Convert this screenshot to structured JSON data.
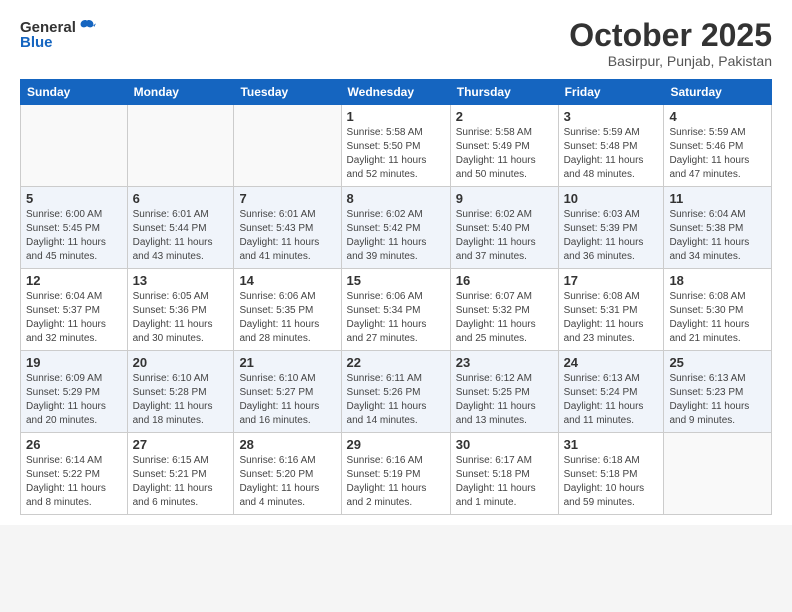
{
  "logo": {
    "general": "General",
    "blue": "Blue"
  },
  "header": {
    "month": "October 2025",
    "location": "Basirpur, Punjab, Pakistan"
  },
  "weekdays": [
    "Sunday",
    "Monday",
    "Tuesday",
    "Wednesday",
    "Thursday",
    "Friday",
    "Saturday"
  ],
  "weeks": [
    [
      {
        "day": "",
        "info": ""
      },
      {
        "day": "",
        "info": ""
      },
      {
        "day": "",
        "info": ""
      },
      {
        "day": "1",
        "info": "Sunrise: 5:58 AM\nSunset: 5:50 PM\nDaylight: 11 hours and 52 minutes."
      },
      {
        "day": "2",
        "info": "Sunrise: 5:58 AM\nSunset: 5:49 PM\nDaylight: 11 hours and 50 minutes."
      },
      {
        "day": "3",
        "info": "Sunrise: 5:59 AM\nSunset: 5:48 PM\nDaylight: 11 hours and 48 minutes."
      },
      {
        "day": "4",
        "info": "Sunrise: 5:59 AM\nSunset: 5:46 PM\nDaylight: 11 hours and 47 minutes."
      }
    ],
    [
      {
        "day": "5",
        "info": "Sunrise: 6:00 AM\nSunset: 5:45 PM\nDaylight: 11 hours and 45 minutes."
      },
      {
        "day": "6",
        "info": "Sunrise: 6:01 AM\nSunset: 5:44 PM\nDaylight: 11 hours and 43 minutes."
      },
      {
        "day": "7",
        "info": "Sunrise: 6:01 AM\nSunset: 5:43 PM\nDaylight: 11 hours and 41 minutes."
      },
      {
        "day": "8",
        "info": "Sunrise: 6:02 AM\nSunset: 5:42 PM\nDaylight: 11 hours and 39 minutes."
      },
      {
        "day": "9",
        "info": "Sunrise: 6:02 AM\nSunset: 5:40 PM\nDaylight: 11 hours and 37 minutes."
      },
      {
        "day": "10",
        "info": "Sunrise: 6:03 AM\nSunset: 5:39 PM\nDaylight: 11 hours and 36 minutes."
      },
      {
        "day": "11",
        "info": "Sunrise: 6:04 AM\nSunset: 5:38 PM\nDaylight: 11 hours and 34 minutes."
      }
    ],
    [
      {
        "day": "12",
        "info": "Sunrise: 6:04 AM\nSunset: 5:37 PM\nDaylight: 11 hours and 32 minutes."
      },
      {
        "day": "13",
        "info": "Sunrise: 6:05 AM\nSunset: 5:36 PM\nDaylight: 11 hours and 30 minutes."
      },
      {
        "day": "14",
        "info": "Sunrise: 6:06 AM\nSunset: 5:35 PM\nDaylight: 11 hours and 28 minutes."
      },
      {
        "day": "15",
        "info": "Sunrise: 6:06 AM\nSunset: 5:34 PM\nDaylight: 11 hours and 27 minutes."
      },
      {
        "day": "16",
        "info": "Sunrise: 6:07 AM\nSunset: 5:32 PM\nDaylight: 11 hours and 25 minutes."
      },
      {
        "day": "17",
        "info": "Sunrise: 6:08 AM\nSunset: 5:31 PM\nDaylight: 11 hours and 23 minutes."
      },
      {
        "day": "18",
        "info": "Sunrise: 6:08 AM\nSunset: 5:30 PM\nDaylight: 11 hours and 21 minutes."
      }
    ],
    [
      {
        "day": "19",
        "info": "Sunrise: 6:09 AM\nSunset: 5:29 PM\nDaylight: 11 hours and 20 minutes."
      },
      {
        "day": "20",
        "info": "Sunrise: 6:10 AM\nSunset: 5:28 PM\nDaylight: 11 hours and 18 minutes."
      },
      {
        "day": "21",
        "info": "Sunrise: 6:10 AM\nSunset: 5:27 PM\nDaylight: 11 hours and 16 minutes."
      },
      {
        "day": "22",
        "info": "Sunrise: 6:11 AM\nSunset: 5:26 PM\nDaylight: 11 hours and 14 minutes."
      },
      {
        "day": "23",
        "info": "Sunrise: 6:12 AM\nSunset: 5:25 PM\nDaylight: 11 hours and 13 minutes."
      },
      {
        "day": "24",
        "info": "Sunrise: 6:13 AM\nSunset: 5:24 PM\nDaylight: 11 hours and 11 minutes."
      },
      {
        "day": "25",
        "info": "Sunrise: 6:13 AM\nSunset: 5:23 PM\nDaylight: 11 hours and 9 minutes."
      }
    ],
    [
      {
        "day": "26",
        "info": "Sunrise: 6:14 AM\nSunset: 5:22 PM\nDaylight: 11 hours and 8 minutes."
      },
      {
        "day": "27",
        "info": "Sunrise: 6:15 AM\nSunset: 5:21 PM\nDaylight: 11 hours and 6 minutes."
      },
      {
        "day": "28",
        "info": "Sunrise: 6:16 AM\nSunset: 5:20 PM\nDaylight: 11 hours and 4 minutes."
      },
      {
        "day": "29",
        "info": "Sunrise: 6:16 AM\nSunset: 5:19 PM\nDaylight: 11 hours and 2 minutes."
      },
      {
        "day": "30",
        "info": "Sunrise: 6:17 AM\nSunset: 5:18 PM\nDaylight: 11 hours and 1 minute."
      },
      {
        "day": "31",
        "info": "Sunrise: 6:18 AM\nSunset: 5:18 PM\nDaylight: 10 hours and 59 minutes."
      },
      {
        "day": "",
        "info": ""
      }
    ]
  ]
}
